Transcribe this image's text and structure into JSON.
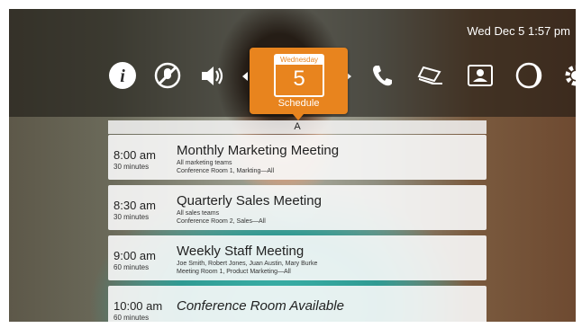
{
  "status": {
    "datetime": "Wed Dec 5 1:57 pm"
  },
  "icons": [
    {
      "name": "info-icon"
    },
    {
      "name": "mute-microphone-icon"
    },
    {
      "name": "volume-icon"
    },
    {
      "name": "phone-icon"
    },
    {
      "name": "laptop-share-icon"
    },
    {
      "name": "presentation-icon"
    },
    {
      "name": "do-not-disturb-icon"
    },
    {
      "name": "settings-icon"
    }
  ],
  "schedule": {
    "weekday": "Wednesday",
    "day": "5",
    "label": "Schedule"
  },
  "section_letter": "A",
  "meetings": [
    {
      "time": "8:00 am",
      "duration": "30 minutes",
      "title": "Monthly Marketing Meeting",
      "line1": "All marketing teams",
      "line2": "Conference Room 1, Markting—All"
    },
    {
      "time": "8:30 am",
      "duration": "30 minutes",
      "title": "Quarterly Sales Meeting",
      "line1": "All sales teams",
      "line2": "Conference Room 2, Sales—All"
    },
    {
      "time": "9:00 am",
      "duration": "60 minutes",
      "title": "Weekly Staff Meeting",
      "line1": "Joe Smith, Robert Jones, Juan Austin, Mary Burke",
      "line2": "Meeting Room 1, Product Marketing—All"
    },
    {
      "time": "10:00 am",
      "duration": "60 minutes",
      "title": "Conference Room Available",
      "line1": "",
      "line2": ""
    }
  ],
  "colors": {
    "accent": "#e8841e",
    "row_bg": "#fafafa"
  }
}
